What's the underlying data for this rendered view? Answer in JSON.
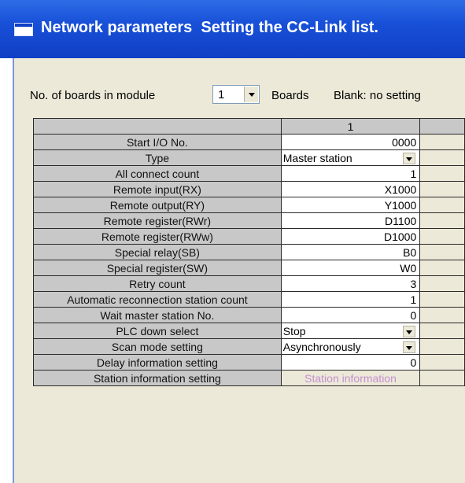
{
  "window": {
    "title": "Network parameters  Setting the CC-Link list."
  },
  "boards": {
    "label": "No. of boards in module",
    "value": "1",
    "unit": "Boards",
    "hint": "Blank: no setting"
  },
  "grid": {
    "column_header": "1",
    "rows": [
      {
        "label": "Start I/O No.",
        "value": "0000",
        "kind": "text"
      },
      {
        "label": "Type",
        "value": "Master station",
        "kind": "select"
      },
      {
        "label": "All connect count",
        "value": "1",
        "kind": "text"
      },
      {
        "label": "Remote input(RX)",
        "value": "X1000",
        "kind": "text"
      },
      {
        "label": "Remote output(RY)",
        "value": "Y1000",
        "kind": "text"
      },
      {
        "label": "Remote register(RWr)",
        "value": "D1100",
        "kind": "text"
      },
      {
        "label": "Remote register(RWw)",
        "value": "D1000",
        "kind": "text"
      },
      {
        "label": "Special relay(SB)",
        "value": "B0",
        "kind": "text"
      },
      {
        "label": "Special register(SW)",
        "value": "W0",
        "kind": "text"
      },
      {
        "label": "Retry count",
        "value": "3",
        "kind": "text"
      },
      {
        "label": "Automatic reconnection station count",
        "value": "1",
        "kind": "text"
      },
      {
        "label": "Wait master station No.",
        "value": "0",
        "kind": "text"
      },
      {
        "label": "PLC down select",
        "value": "Stop",
        "kind": "select"
      },
      {
        "label": "Scan mode setting",
        "value": "Asynchronously",
        "kind": "select"
      },
      {
        "label": "Delay information setting",
        "value": "0",
        "kind": "text"
      },
      {
        "label": "Station information setting",
        "value": "Station information",
        "kind": "button"
      }
    ]
  },
  "colors": {
    "titlebar": "#0f3fc4",
    "window_bg": "#ece9d8",
    "grid_header": "#c8c8c8",
    "disabled_button_text": "#c58fd0"
  },
  "icons": {
    "title": "window-icon",
    "dropdown": "chevron-down-icon"
  }
}
